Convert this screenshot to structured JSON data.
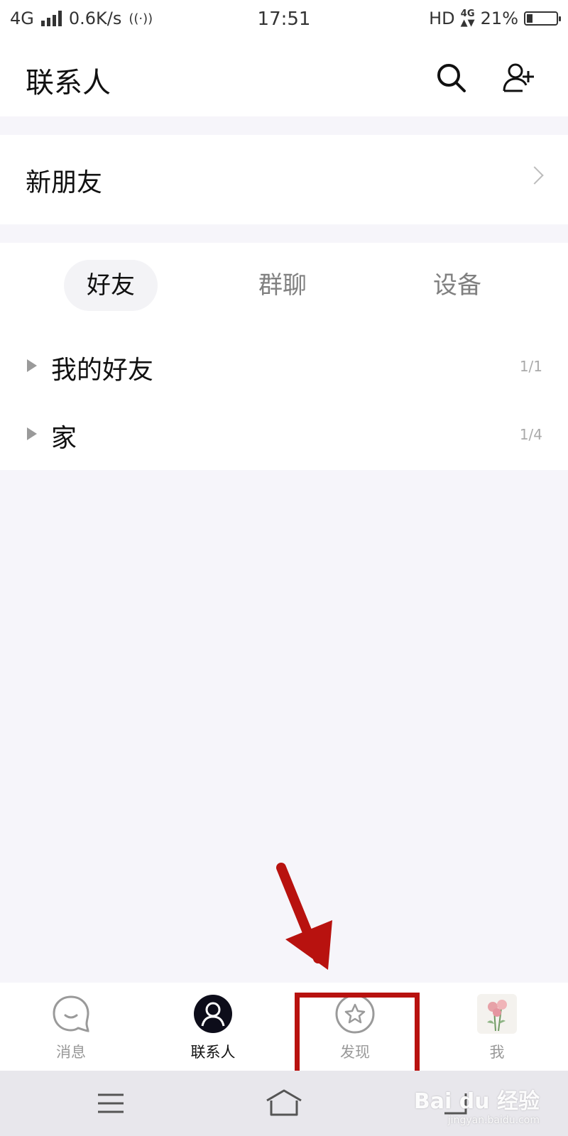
{
  "status_bar": {
    "network": "4G",
    "speed": "0.6K/s",
    "time": "17:51",
    "hd": "HD",
    "net_small": "4G",
    "battery": "21%"
  },
  "header": {
    "title": "联系人"
  },
  "new_friends": {
    "label": "新朋友"
  },
  "tabs": [
    {
      "label": "好友",
      "active": true
    },
    {
      "label": "群聊",
      "active": false
    },
    {
      "label": "设备",
      "active": false
    }
  ],
  "groups": [
    {
      "name": "我的好友",
      "count": "1/1"
    },
    {
      "name": "家",
      "count": "1/4"
    }
  ],
  "tab_bar": [
    {
      "label": "消息",
      "icon": "chat-bubble-icon",
      "active": false
    },
    {
      "label": "联系人",
      "icon": "contact-person-icon",
      "active": true
    },
    {
      "label": "发现",
      "icon": "discover-star-icon",
      "active": false
    },
    {
      "label": "我",
      "icon": "avatar-flower-icon",
      "active": false
    }
  ],
  "watermark": {
    "text": "Bai du 经验",
    "sub": "jingyan.baidu.com"
  },
  "colors": {
    "annotation": "#b8120f",
    "active_tab_icon": "#111111",
    "inactive": "#999999"
  }
}
